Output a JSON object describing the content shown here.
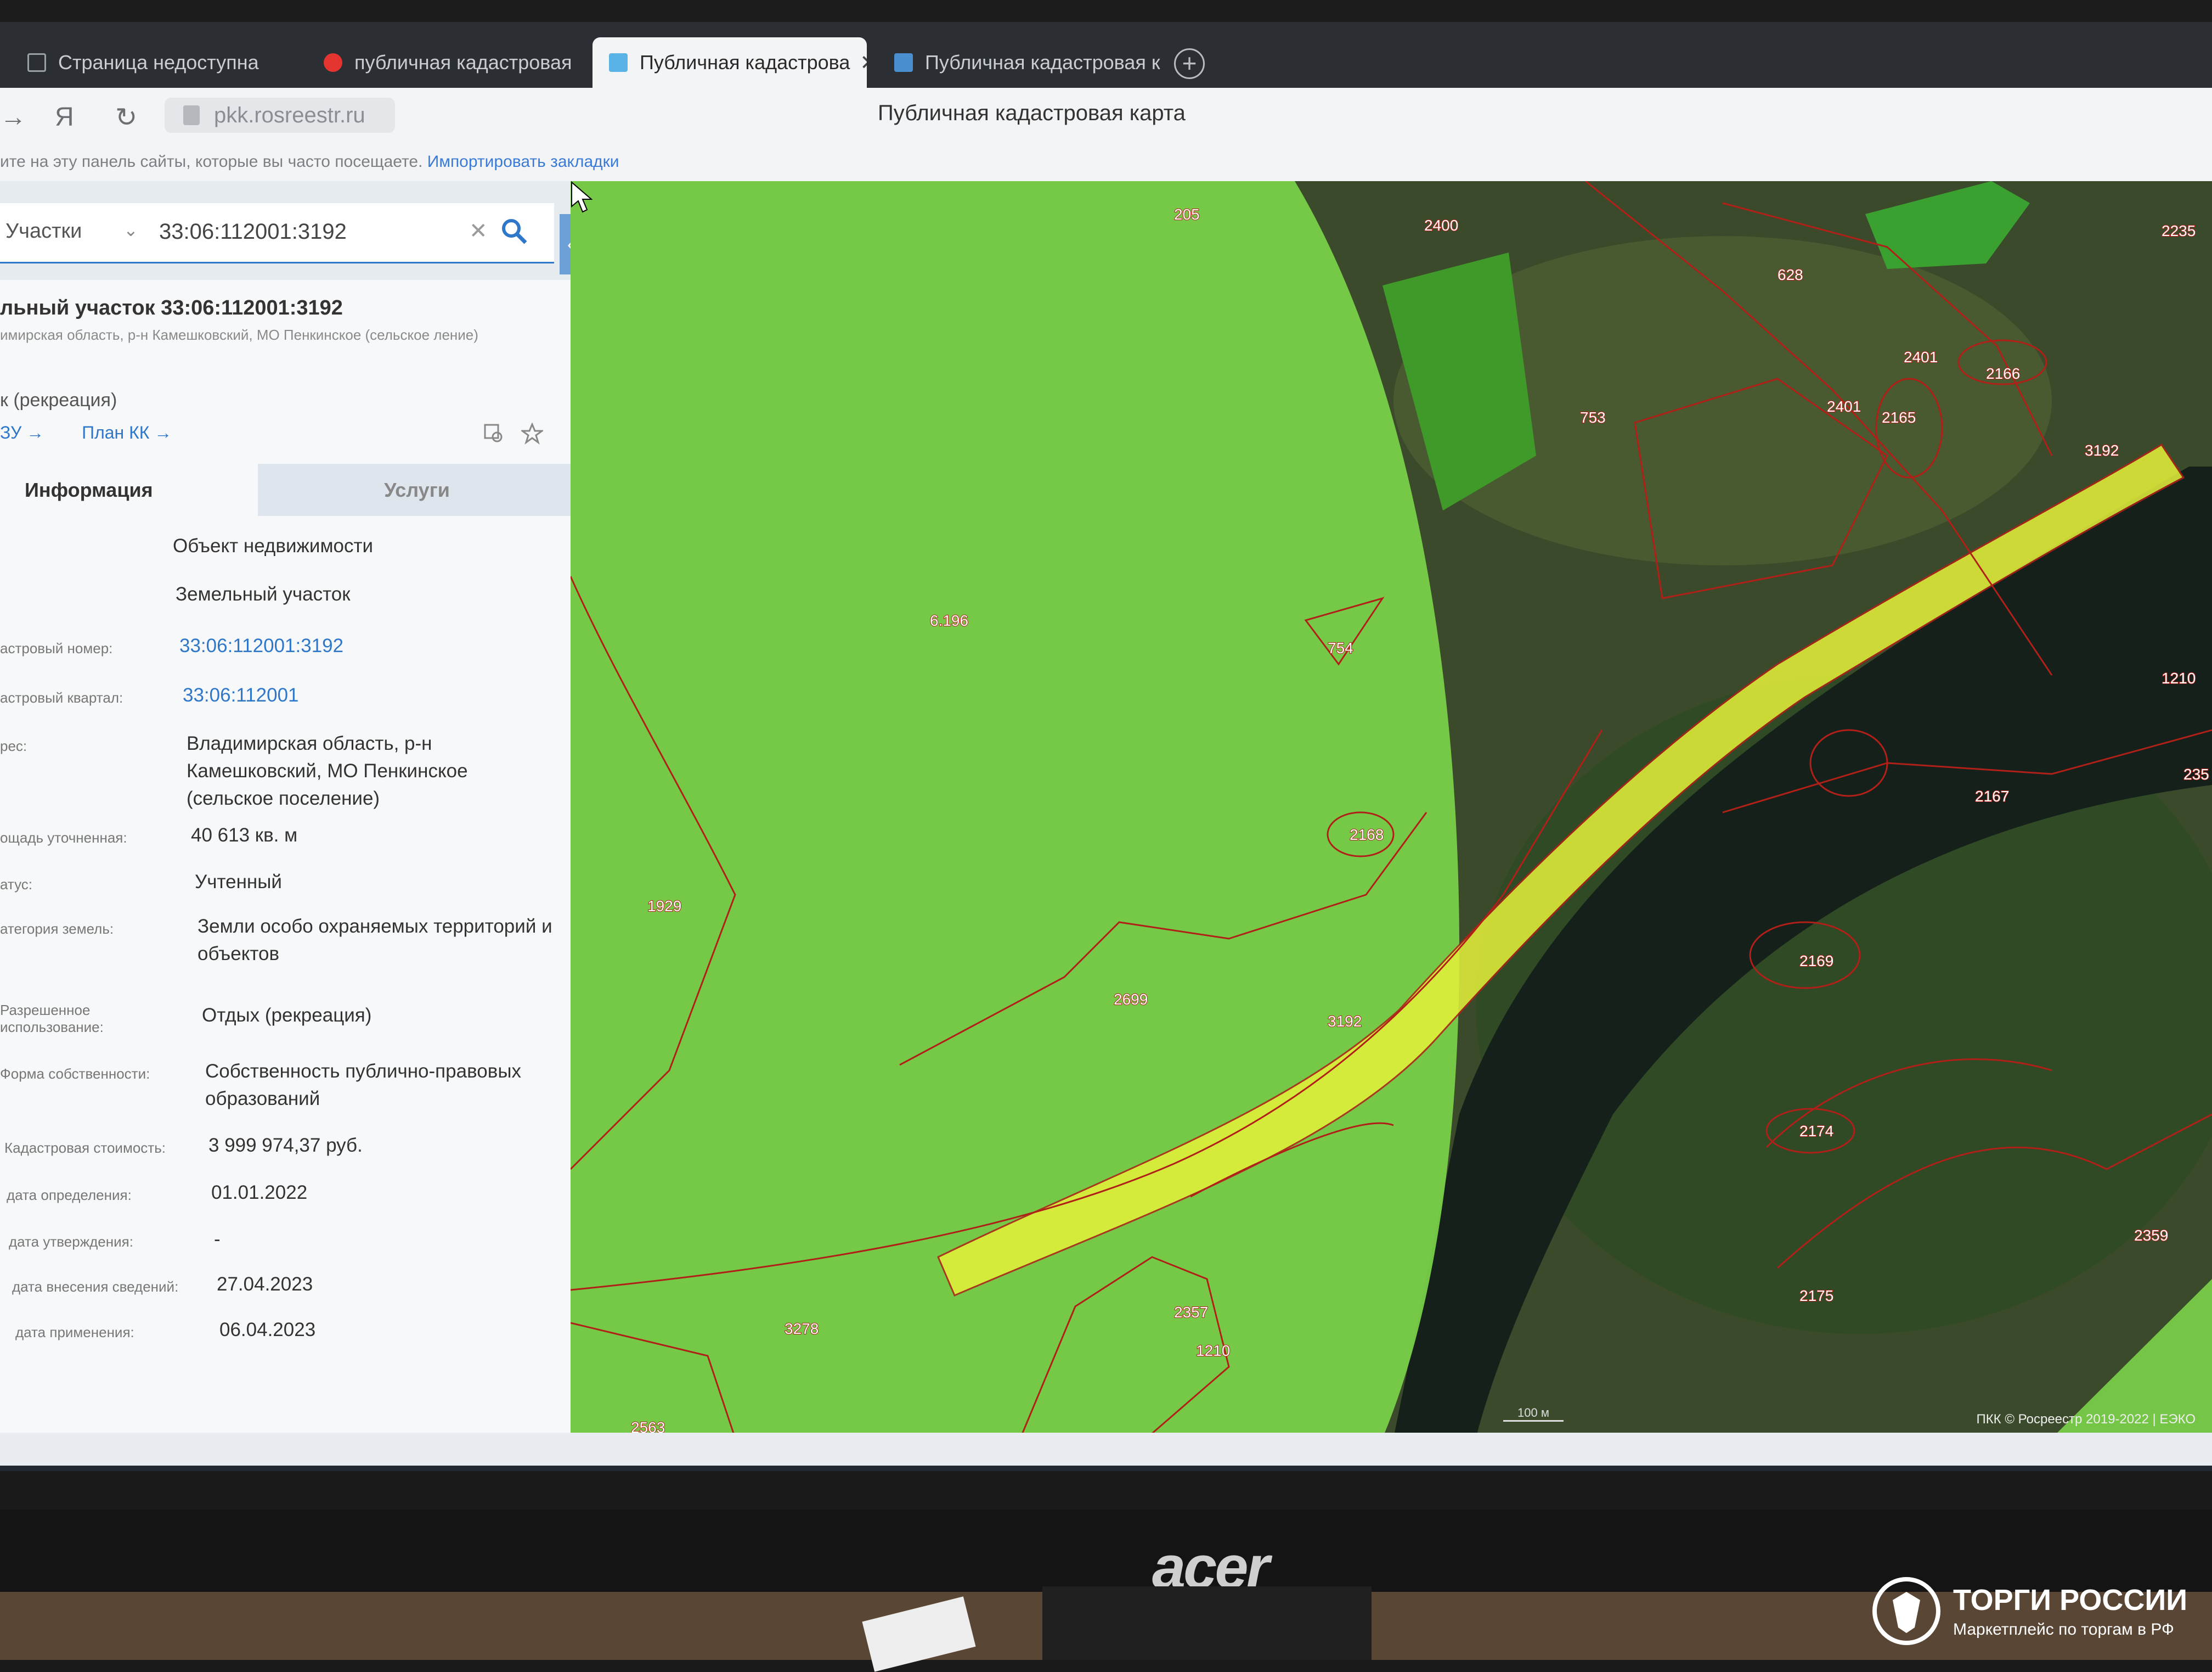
{
  "browser": {
    "tabs": [
      {
        "label": "Страница недоступна",
        "active": false
      },
      {
        "label": "публичная кадастровая",
        "active": false
      },
      {
        "label": "Публичная кадастрова",
        "active": true
      },
      {
        "label": "Публичная кадастровая к",
        "active": false
      }
    ],
    "new_tab_label": "+",
    "url": "pkk.rosreestr.ru",
    "page_title": "Публичная кадастровая карта",
    "bookmarks_hint": "ите на эту панель сайты, которые вы часто посещаете.",
    "bookmarks_import": "Импортировать закладки"
  },
  "panel": {
    "search_type": "Участки",
    "search_value": "33:06:112001:3192",
    "object_title": "льный участок 33:06:112001:3192",
    "object_address_short": "имирская область, р-н Камешковский, МО Пенкинское (сельское ление)",
    "object_use_short": "к (рекреация)",
    "links": [
      "ЗУ →",
      "План КК →"
    ],
    "tabs": {
      "info": "Информация",
      "services": "Услуги"
    },
    "fields": [
      {
        "label": "",
        "value": "Объект недвижимости"
      },
      {
        "label": "",
        "value": "Земельный участок"
      },
      {
        "label": "астровый номер:",
        "value": "33:06:112001:3192"
      },
      {
        "label": "астровый квартал:",
        "value": "33:06:112001"
      },
      {
        "label": "рес:",
        "value": "Владимирская область, р-н Камешковский, МО Пенкинское (сельское поселение)"
      },
      {
        "label": "ощадь уточненная:",
        "value": "40 613 кв. м"
      },
      {
        "label": "атус:",
        "value": "Учтенный"
      },
      {
        "label": "атегория земель:",
        "value": "Земли особо охраняемых территорий и объектов"
      },
      {
        "label": "Разрешенное использование:",
        "value": "Отдых (рекреация)"
      },
      {
        "label": "Форма собственности:",
        "value": "Собственность публично-правовых образований"
      },
      {
        "label": "Кадастровая стоимость:",
        "value": "3 999 974,37 руб."
      },
      {
        "label": "дата определения:",
        "value": "01.01.2022"
      },
      {
        "label": "дата утверждения:",
        "value": "-"
      },
      {
        "label": "дата внесения сведений:",
        "value": "27.04.2023"
      },
      {
        "label": "дата применения:",
        "value": "06.04.2023"
      }
    ]
  },
  "map": {
    "labels": [
      "205",
      "2400",
      "628",
      "2235",
      "2401",
      "2166",
      "2401",
      "2165",
      "753",
      "3192",
      "6.196",
      "754",
      "1210",
      "2167",
      "235",
      "2168",
      "1929",
      "2699",
      "3192",
      "2169",
      "2174",
      "2359",
      "2175",
      "3278",
      "2357",
      "1210",
      "2563"
    ],
    "attribution": "ПКК  © Росреестр 2019-2022 | ЕЭКО",
    "scale": "100 м",
    "colors": {
      "zone": "#7cd44a",
      "parcel": "#e6f23a",
      "border": "#b02018",
      "water": "#15201a"
    }
  },
  "monitor": {
    "brand": "acer"
  },
  "watermark": {
    "title": "ТОРГИ РОССИИ",
    "subtitle": "Маркетплейс по торгам в РФ"
  }
}
